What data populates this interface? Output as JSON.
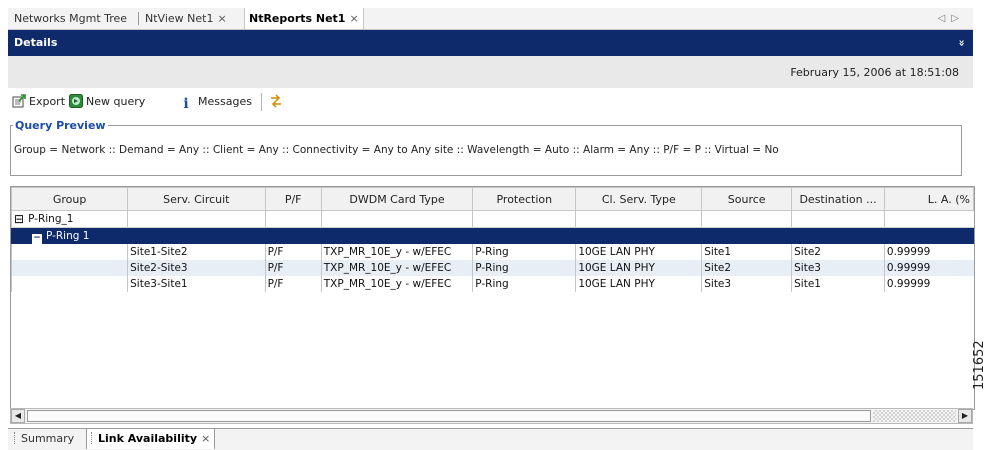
{
  "tabs": [
    {
      "label": "Networks Mgmt Tree",
      "active": false,
      "closable": false
    },
    {
      "label": "NtView Net1",
      "active": false,
      "closable": true
    },
    {
      "label": "NtReports Net1",
      "active": true,
      "closable": true
    }
  ],
  "tab_close_glyph": "×",
  "tab_nav": {
    "left": "◁",
    "right": "▷"
  },
  "details": {
    "title": "Details",
    "collapse_glyph": "»"
  },
  "timestamp": "February 15, 2006 at 18:51:08",
  "toolbar": {
    "export_label": "Export",
    "new_query_label": "New query",
    "messages_label": "Messages",
    "icons": [
      "export-icon",
      "new-query-icon",
      "info-icon",
      "refresh-icon"
    ]
  },
  "query_preview": {
    "title": "Query Preview",
    "text": "Group = Network :: Demand = Any :: Client = Any :: Connectivity = Any to Any site :: Wavelength = Auto :: Alarm = Any :: P/F = P :: Virtual = No"
  },
  "table": {
    "columns": [
      "Group",
      "Serv. Circuit",
      "P/F",
      "DWDM Card Type",
      "Protection",
      "Cl. Serv. Type",
      "Source",
      "Destination ...",
      "L. A. (%"
    ],
    "group_row": {
      "expander": "⊟",
      "label": "P-Ring_1"
    },
    "subgroup_row": {
      "expander": "−",
      "label": "P-Ring 1"
    },
    "rows": [
      [
        "",
        "Site1-Site2",
        "P/F",
        "TXP_MR_10E_y - w/EFEC",
        "P-Ring",
        "10GE LAN PHY",
        "Site1",
        "Site2",
        "0.99999"
      ],
      [
        "",
        "Site2-Site3",
        "P/F",
        "TXP_MR_10E_y - w/EFEC",
        "P-Ring",
        "10GE LAN PHY",
        "Site2",
        "Site3",
        "0.99999"
      ],
      [
        "",
        "Site3-Site1",
        "P/F",
        "TXP_MR_10E_y - w/EFEC",
        "P-Ring",
        "10GE LAN PHY",
        "Site3",
        "Site1",
        "0.99999"
      ]
    ]
  },
  "scrollbar": {
    "left_glyph": "◀",
    "right_glyph": "▶"
  },
  "bottom_tabs": [
    {
      "label": "Summary",
      "active": false
    },
    {
      "label": "Link Availability",
      "active": true
    }
  ],
  "figure_id": "151652",
  "colors": {
    "header_navy": "#0e2a6b",
    "preview_title_blue": "#1a4ca8",
    "alt_row": "#e8eef6"
  }
}
